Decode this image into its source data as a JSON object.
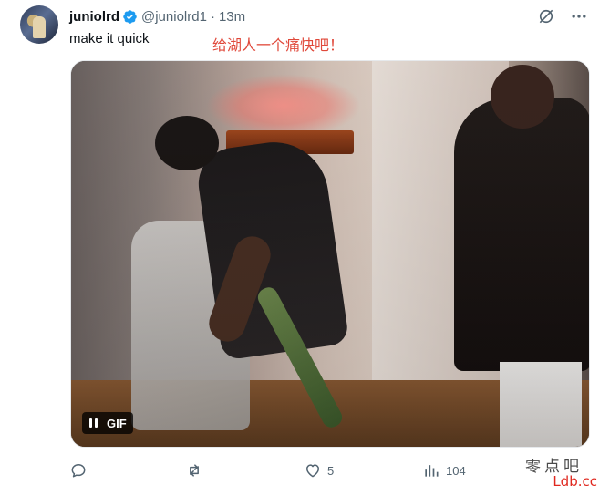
{
  "tweet": {
    "display_name": "juniolrd",
    "handle": "@juniolrd1",
    "separator": "·",
    "time": "13m",
    "text": "make it quick",
    "overlay_caption": "给湖人一个痛快吧！",
    "verified_color": "#1d9bf0"
  },
  "media": {
    "badge": "GIF",
    "control_icon": "pause-icon"
  },
  "actions": {
    "reply_count": "",
    "retweet_count": "",
    "like_count": "5",
    "view_count": "104"
  },
  "icons": {
    "verified": "verified-badge-icon",
    "grok": "grok-icon",
    "more": "more-icon",
    "reply": "reply-icon",
    "retweet": "retweet-icon",
    "like": "heart-icon",
    "views": "views-icon"
  },
  "watermark": {
    "line1": "零点吧",
    "line2": "Ldb.cc"
  }
}
